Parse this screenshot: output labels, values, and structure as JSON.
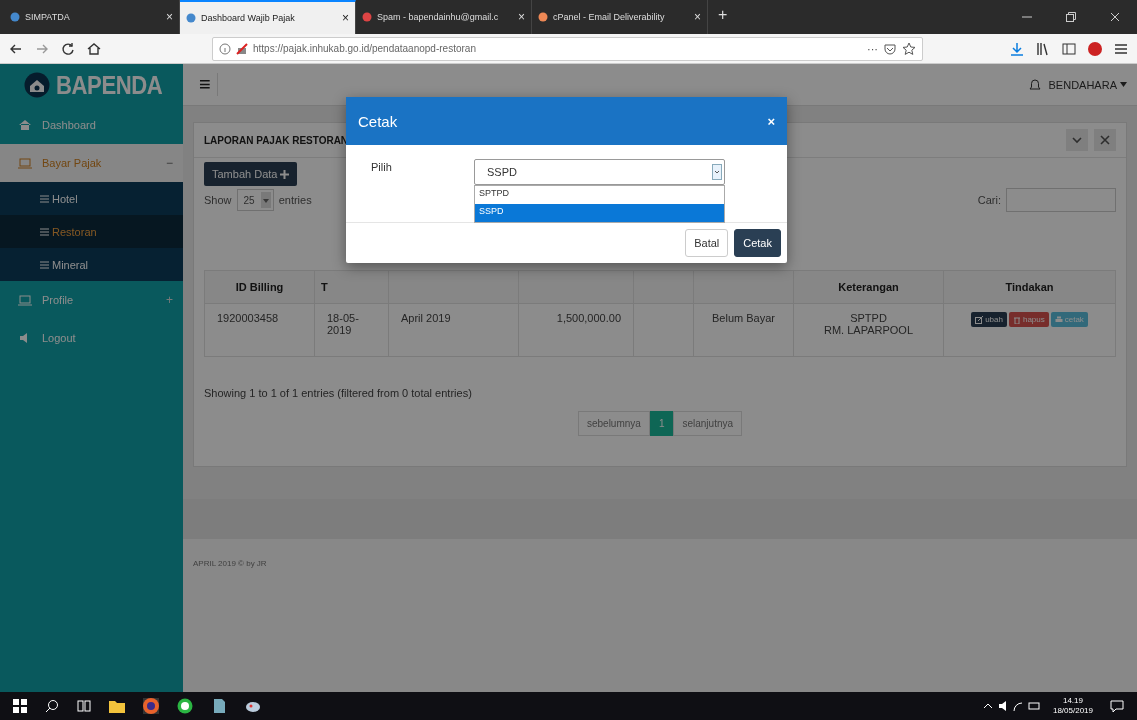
{
  "browser": {
    "tabs": [
      {
        "label": "SIMPATDA",
        "selected": false,
        "close": "×"
      },
      {
        "label": "Dashboard Wajib Pajak",
        "selected": true,
        "close": "×"
      },
      {
        "label": "Spam - bapendainhu@gmail.c",
        "selected": false,
        "close": "×"
      },
      {
        "label": "cPanel - Email Deliverability",
        "selected": false,
        "close": "×"
      }
    ],
    "new_tab": "+",
    "address": "https://pajak.inhukab.go.id/pendataanopd-restoran",
    "address_actions": "···"
  },
  "sidebar": {
    "logo": "BAPENDA",
    "items": [
      {
        "label": "Dashboard",
        "selected": false,
        "marker": ""
      },
      {
        "label": "Bayar Pajak",
        "selected": true,
        "marker": "−",
        "expanded": true,
        "children": [
          {
            "label": "Hotel",
            "selected": false
          },
          {
            "label": "Restoran",
            "selected": true
          },
          {
            "label": "Mineral",
            "selected": false
          }
        ]
      },
      {
        "label": "Profile",
        "selected": false,
        "marker": "+",
        "expanded": false
      },
      {
        "label": "Logout",
        "selected": false,
        "marker": ""
      }
    ]
  },
  "header": {
    "menu": "≡",
    "user": "BENDAHARA"
  },
  "card": {
    "title": "LAPORAN PAJAK RESTORAN",
    "add_button": "Tambah Data",
    "show_label": "Show",
    "page_size": "25",
    "entries_label": "entries",
    "search_label": "Cari:",
    "columns": [
      "ID Billing",
      "T",
      "",
      "",
      "",
      "",
      "Keterangan",
      "Tindakan"
    ],
    "rows": [
      {
        "cells": [
          "1920003458",
          "18-05-2019",
          "April 2019",
          "1,500,000.00",
          "",
          "Belum Bayar"
        ],
        "note": [
          "SPTPD",
          "RM. LAPARPOOL"
        ],
        "actions": [
          {
            "label": "ubah",
            "kind": "edit"
          },
          {
            "label": "hapus",
            "kind": "delete"
          },
          {
            "label": "cetak",
            "kind": "print"
          }
        ]
      }
    ],
    "info": "Showing 1 to 1 of 1 entries (filtered from 0 total entries)",
    "pagination": [
      {
        "label": "sebelumnya",
        "selected": false
      },
      {
        "label": "1",
        "selected": true
      },
      {
        "label": "selanjutnya",
        "selected": false
      }
    ]
  },
  "footer": "APRIL 2019 © by JR",
  "modal": {
    "title": "Cetak",
    "close": "×",
    "field_label": "Pilih",
    "select": {
      "value": "SSPD",
      "expanded": true,
      "options": [
        {
          "label": "SPTPD",
          "selected": false
        },
        {
          "label": "SSPD",
          "selected": true
        }
      ]
    },
    "buttons": [
      {
        "label": "Batal",
        "kind": "default"
      },
      {
        "label": "Cetak",
        "kind": "primary"
      }
    ]
  },
  "taskbar": {
    "time": "14.19",
    "date": "18/05/2019"
  }
}
